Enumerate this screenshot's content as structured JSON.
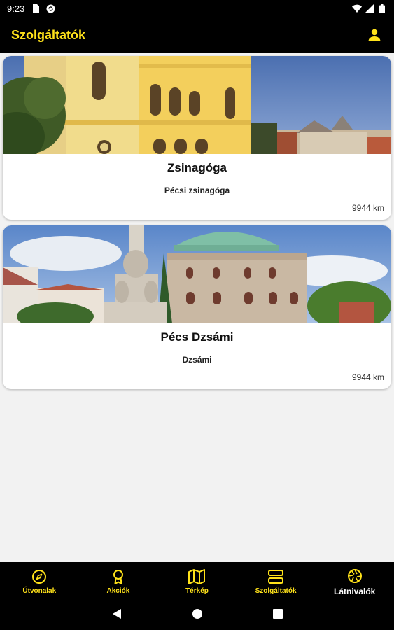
{
  "status_bar": {
    "time": "9:23",
    "icons": [
      "sd-card-icon",
      "sync-icon",
      "wifi-icon",
      "signal-icon",
      "battery-icon"
    ]
  },
  "app_bar": {
    "title": "Szolgáltatók",
    "profile_icon": "person-icon"
  },
  "cards": [
    {
      "title": "Zsinagóga",
      "subtitle": "Pécsi zsinagóga",
      "distance": "9944 km",
      "image": "synagogue-photo"
    },
    {
      "title": "Pécs Dzsámi",
      "subtitle": "Dzsámi",
      "distance": "9944 km",
      "image": "mosque-photo"
    }
  ],
  "bottom_nav": {
    "items": [
      {
        "label": "Útvonalak",
        "icon": "compass-icon",
        "active": false
      },
      {
        "label": "Akciók",
        "icon": "award-icon",
        "active": false
      },
      {
        "label": "Térkép",
        "icon": "map-icon",
        "active": false
      },
      {
        "label": "Szolgáltatók",
        "icon": "servers-icon",
        "active": false
      },
      {
        "label": "Látnivalók",
        "icon": "aperture-icon",
        "active": true
      }
    ]
  },
  "colors": {
    "accent": "#ffe21a",
    "bar_background": "#000000",
    "page_background": "#f2f2f2"
  }
}
